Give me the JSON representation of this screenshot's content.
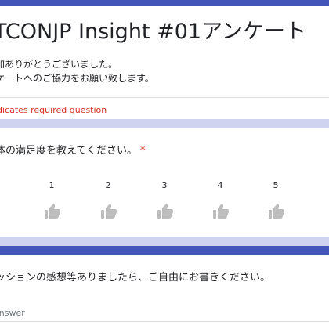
{
  "header": {
    "title": "TCONJP Insight #01アンケート",
    "description_line_1": "加ありがとうございました。",
    "description_line_2": "ケートへのご協力をお願い致します。",
    "required_note": "dicates required question"
  },
  "question_1": {
    "text": "体の満足度を教えてください。",
    "required_marker": "*",
    "scale_labels": [
      "1",
      "2",
      "3",
      "4",
      "5"
    ],
    "scale_icon": "thumbs-up-icon"
  },
  "question_2": {
    "text": "ッションの感想等ありましたら、ご自由にお書きください。",
    "answer_placeholder": "r answer",
    "answer_value": ""
  },
  "colors": {
    "page_background": "#cfd3ef",
    "accent": "#4355b9",
    "required": "#d93025",
    "icon_gray": "#bdbdbd",
    "text": "#202124"
  }
}
